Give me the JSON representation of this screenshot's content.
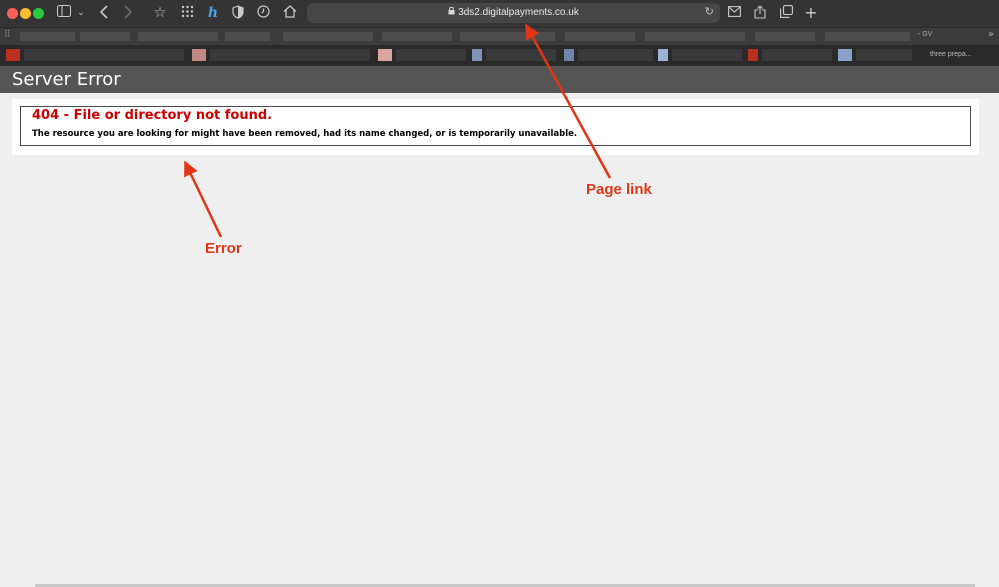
{
  "browser": {
    "url": "3ds2.digitalpayments.co.uk",
    "favorites_right_label": "- GV",
    "tab_right_label": "three prepa...",
    "icons": {
      "sidebar": "sidebar-icon",
      "back": "chevron-left-icon",
      "forward": "chevron-right-icon",
      "lock": "lock-icon",
      "reload": "reload-icon"
    }
  },
  "page": {
    "header_title": "Server Error",
    "error_heading": "404 - File or directory not found.",
    "error_message": "The resource you are looking for might have been removed, had its name changed, or is temporarily unavailable."
  },
  "annotations": {
    "page_link": "Page link",
    "error": "Error"
  },
  "colors": {
    "header_bg": "#555555",
    "error_red": "#cc0000",
    "annotation_red": "#e03616"
  }
}
